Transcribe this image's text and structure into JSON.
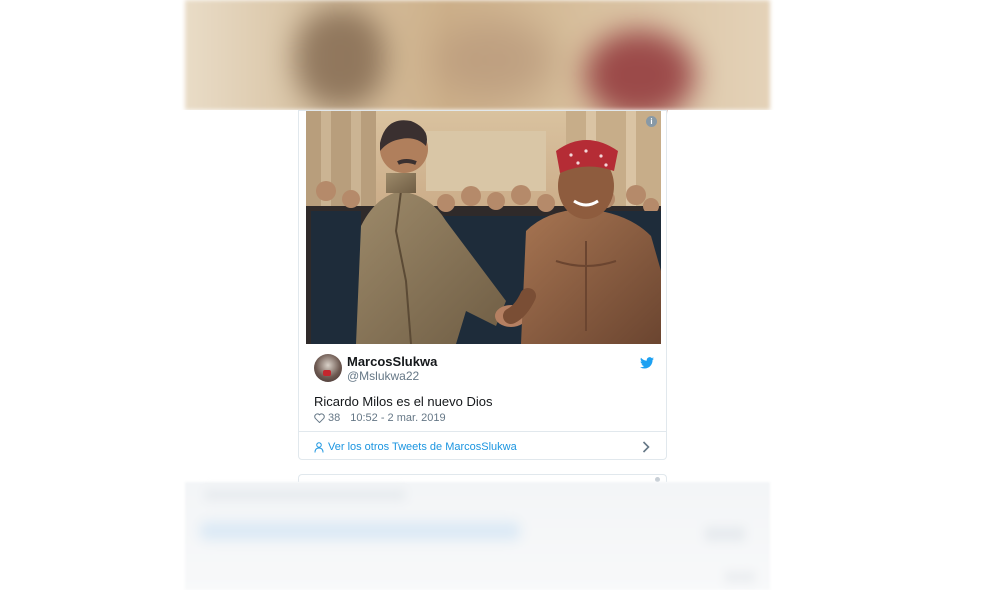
{
  "tweet": {
    "author_name": "MarcosSlukwa",
    "author_handle": "@Mslukwa22",
    "text": "Ricardo Milos es el nuevo Dios",
    "likes": "38",
    "timestamp": "10:52 - 2 mar. 2019",
    "more_tweets_link": "Ver los otros Tweets de MarcosSlukwa",
    "info_icon": "i"
  },
  "icons": {
    "bird": "twitter-bird-icon",
    "heart": "heart-icon",
    "person": "person-icon",
    "chevron": "chevron-right-icon",
    "info": "info-icon"
  },
  "colors": {
    "link": "#1b95e0",
    "muted": "#657786",
    "text": "#14171a",
    "border": "#e1e8ed"
  }
}
